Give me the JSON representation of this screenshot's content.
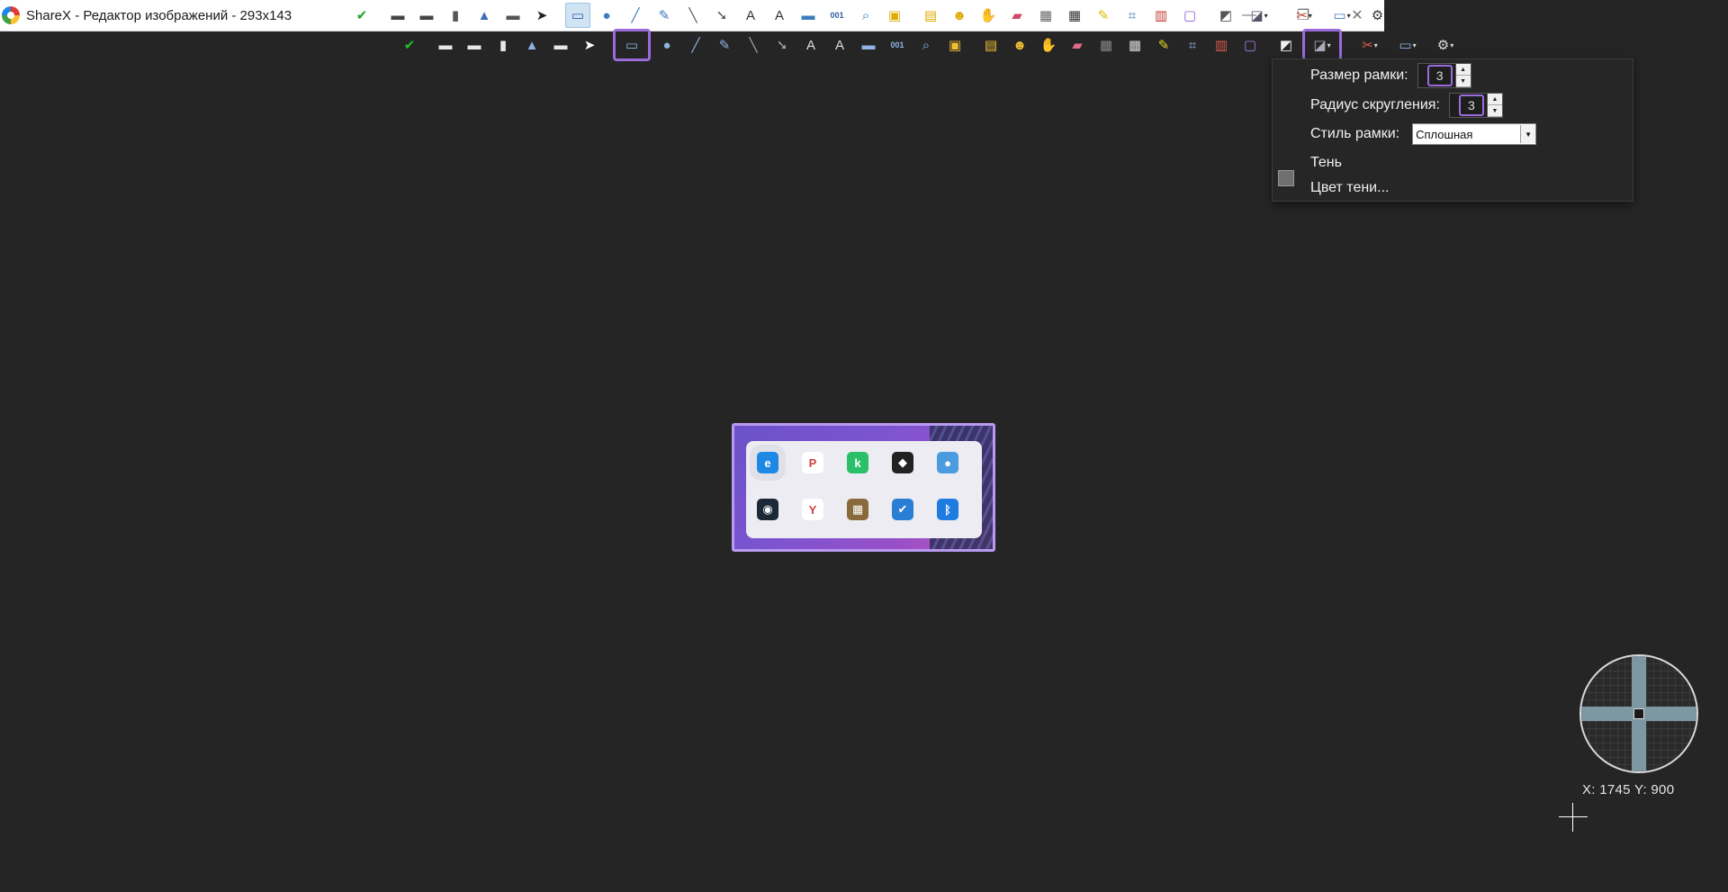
{
  "window": {
    "title": "ShareX - Редактор изображений - 293x143",
    "minimize_glyph": "—",
    "maximize_glyph": "❐",
    "close_glyph": "✕"
  },
  "toolbar_primary": [
    {
      "icon": "confirm-icon",
      "glyph": "✔",
      "color": "#1fa21f"
    },
    {
      "icon": "save-icon",
      "glyph": "▬",
      "color": "#444"
    },
    {
      "icon": "save-as-icon",
      "glyph": "▬",
      "color": "#444"
    },
    {
      "icon": "copy-icon",
      "glyph": "▮",
      "color": "#555"
    },
    {
      "icon": "upload-icon",
      "glyph": "▲",
      "color": "#3b6fb6"
    },
    {
      "icon": "print-icon",
      "glyph": "▬",
      "color": "#555"
    },
    {
      "icon": "select-icon",
      "glyph": "➤",
      "color": "#222"
    },
    {
      "icon": "rectangle-icon",
      "glyph": "▭",
      "color": "#2f5f9f",
      "active": true
    },
    {
      "icon": "ellipse-icon",
      "glyph": "●",
      "color": "#3d7bbf"
    },
    {
      "icon": "freehand-icon",
      "glyph": "╱",
      "color": "#3d7bbf"
    },
    {
      "icon": "smart-pen-icon",
      "glyph": "✎",
      "color": "#3d7bbf"
    },
    {
      "icon": "line-icon",
      "glyph": "╲",
      "color": "#555"
    },
    {
      "icon": "arrow-icon",
      "glyph": "➘",
      "color": "#555"
    },
    {
      "icon": "text-outline-icon",
      "glyph": "A",
      "color": "#333"
    },
    {
      "icon": "text-background-icon",
      "glyph": "A",
      "color": "#333"
    },
    {
      "icon": "speech-balloon-icon",
      "glyph": "▬",
      "color": "#3d7bbf"
    },
    {
      "icon": "step-icon",
      "glyph": "001",
      "color": "#2f5f9f"
    },
    {
      "icon": "magnify-icon",
      "glyph": "⌕",
      "color": "#3d7bbf"
    },
    {
      "icon": "image-file-icon",
      "glyph": "▣",
      "color": "#e0a800"
    },
    {
      "icon": "image-screen-icon",
      "glyph": "▤",
      "color": "#e0a800"
    },
    {
      "icon": "sticker-icon",
      "glyph": "☻",
      "color": "#e0a800"
    },
    {
      "icon": "cursor-icon",
      "glyph": "✋",
      "color": "#c97a2b"
    },
    {
      "icon": "eraser-icon",
      "glyph": "▰",
      "color": "#d14a6a"
    },
    {
      "icon": "blur-icon",
      "glyph": "▦",
      "color": "#666"
    },
    {
      "icon": "pixelate-icon",
      "glyph": "▦",
      "color": "#333"
    },
    {
      "icon": "highlight-icon",
      "glyph": "✎",
      "color": "#d4c000"
    },
    {
      "icon": "crop-icon",
      "glyph": "⌗",
      "color": "#3d7bbf"
    },
    {
      "icon": "cut-out-icon",
      "glyph": "▥",
      "color": "#c0392b"
    },
    {
      "icon": "border-color-icon",
      "glyph": "▢",
      "color": "#8a5ad8"
    },
    {
      "icon": "fill-color-icon",
      "glyph": "◩",
      "color": "#555"
    },
    {
      "icon": "shadow-icon",
      "glyph": "◪",
      "color": "#556",
      "caret": true
    },
    {
      "icon": "tools-icon",
      "glyph": "✂",
      "color": "#c0392b",
      "caret": true
    },
    {
      "icon": "image-effects-icon",
      "glyph": "▭",
      "color": "#3d7bbf",
      "caret": true
    },
    {
      "icon": "settings-icon",
      "glyph": "⚙",
      "color": "#333",
      "caret": true
    }
  ],
  "toolbar_secondary": [
    {
      "icon": "confirm-icon",
      "glyph": "✔",
      "color": "#22c322"
    },
    {
      "icon": "save-icon",
      "glyph": "▬",
      "color": "#e8e8e8"
    },
    {
      "icon": "save-as-icon",
      "glyph": "▬",
      "color": "#e8e8e8"
    },
    {
      "icon": "copy-icon",
      "glyph": "▮",
      "color": "#e8e8e8"
    },
    {
      "icon": "upload-icon",
      "glyph": "▲",
      "color": "#8fb3e3"
    },
    {
      "icon": "print-icon",
      "glyph": "▬",
      "color": "#e8e8e8"
    },
    {
      "icon": "select-icon",
      "glyph": "➤",
      "color": "#fff"
    },
    {
      "icon": "rectangle-icon",
      "glyph": "▭",
      "color": "#8fb3e3",
      "active": true
    },
    {
      "icon": "ellipse-icon",
      "glyph": "●",
      "color": "#8fb3e3"
    },
    {
      "icon": "freehand-icon",
      "glyph": "╱",
      "color": "#8fb3e3"
    },
    {
      "icon": "smart-pen-icon",
      "glyph": "✎",
      "color": "#8fb3e3"
    },
    {
      "icon": "line-icon",
      "glyph": "╲",
      "color": "#aaa"
    },
    {
      "icon": "arrow-icon",
      "glyph": "➘",
      "color": "#aaa"
    },
    {
      "icon": "text-outline-icon",
      "glyph": "A",
      "color": "#ddd"
    },
    {
      "icon": "text-background-icon",
      "glyph": "A",
      "color": "#ddd"
    },
    {
      "icon": "speech-balloon-icon",
      "glyph": "▬",
      "color": "#8fb3e3"
    },
    {
      "icon": "step-icon",
      "glyph": "001",
      "color": "#8fb3e3"
    },
    {
      "icon": "magnify-icon",
      "glyph": "⌕",
      "color": "#8fb3e3"
    },
    {
      "icon": "image-file-icon",
      "glyph": "▣",
      "color": "#f0c030"
    },
    {
      "icon": "image-screen-icon",
      "glyph": "▤",
      "color": "#f0c030"
    },
    {
      "icon": "sticker-icon",
      "glyph": "☻",
      "color": "#f0c030"
    },
    {
      "icon": "cursor-icon",
      "glyph": "✋",
      "color": "#e09a4a"
    },
    {
      "icon": "eraser-icon",
      "glyph": "▰",
      "color": "#e46a8a"
    },
    {
      "icon": "blur-icon",
      "glyph": "▦",
      "color": "#888"
    },
    {
      "icon": "pixelate-icon",
      "glyph": "▦",
      "color": "#ddd"
    },
    {
      "icon": "highlight-icon",
      "glyph": "✎",
      "color": "#e8d820"
    },
    {
      "icon": "crop-icon",
      "glyph": "⌗",
      "color": "#8fb3e3"
    },
    {
      "icon": "cut-out-icon",
      "glyph": "▥",
      "color": "#e05a4a"
    },
    {
      "icon": "border-color-icon",
      "glyph": "▢",
      "color": "#a57ae8"
    },
    {
      "icon": "fill-color-icon",
      "glyph": "◩",
      "color": "#eee"
    },
    {
      "icon": "shadow-icon",
      "glyph": "◪",
      "color": "#aab",
      "caret": true,
      "open": true
    },
    {
      "icon": "tools-icon",
      "glyph": "✂",
      "color": "#e05a4a",
      "caret": true
    },
    {
      "icon": "image-effects-icon",
      "glyph": "▭",
      "color": "#8fb3e3",
      "caret": true
    },
    {
      "icon": "settings-icon",
      "glyph": "⚙",
      "color": "#ddd",
      "caret": true
    }
  ],
  "popup": {
    "border_size_label": "Размер рамки:",
    "border_size_value": "3",
    "corner_radius_label": "Радиус скругления:",
    "corner_radius_value": "3",
    "border_style_label": "Стиль рамки:",
    "border_style_value": "Сплошная",
    "shadow_label": "Тень",
    "shadow_color_label": "Цвет тени...",
    "shadow_color": "#6f6f6f",
    "spin_up": "▲",
    "spin_down": "▼",
    "dropdown_arrow": "▼"
  },
  "preview_image": {
    "tray_icons_row1": [
      {
        "icon": "edge-icon",
        "glyph": "e",
        "bg": "#1e88e5",
        "highlighted": true
      },
      {
        "icon": "pdf-app-icon",
        "glyph": "P",
        "bg": "#ffffff"
      },
      {
        "icon": "kaspersky-icon",
        "glyph": "k",
        "bg": "#2bbf6a"
      },
      {
        "icon": "nvidia-icon",
        "glyph": "◆",
        "bg": "#222"
      },
      {
        "icon": "network-icon",
        "glyph": "●",
        "bg": "#4a9be0"
      }
    ],
    "tray_icons_row2": [
      {
        "icon": "steam-icon",
        "glyph": "◉",
        "bg": "#1b2838"
      },
      {
        "icon": "yandex-browser-icon",
        "glyph": "Y",
        "bg": "#ffffff"
      },
      {
        "icon": "color-app-icon",
        "glyph": "▦",
        "bg": "#8a6a3a"
      },
      {
        "icon": "windows-security-icon",
        "glyph": "✔",
        "bg": "#2a7fd4"
      },
      {
        "icon": "bluetooth-icon",
        "glyph": "ᛒ",
        "bg": "#1e7be0"
      }
    ]
  },
  "cursor_info": {
    "coords": "X: 1745 Y: 900"
  }
}
